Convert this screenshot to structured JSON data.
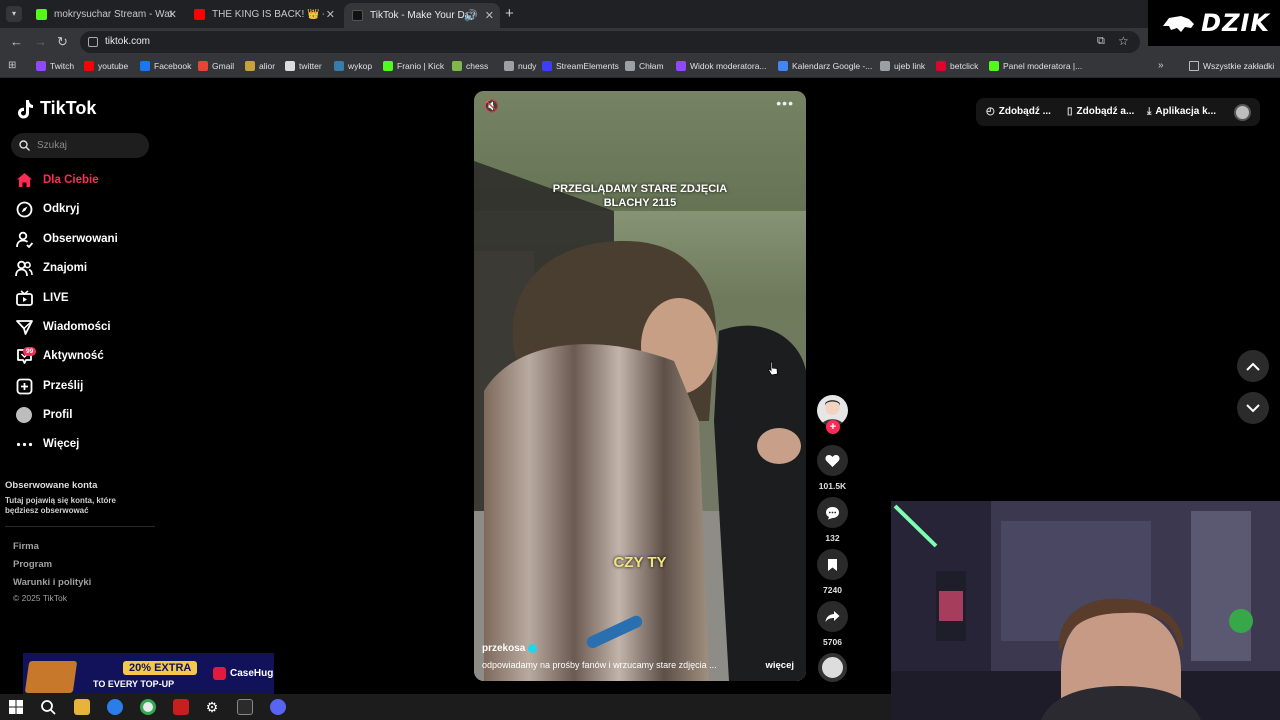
{
  "browser": {
    "tabs": [
      {
        "title": "mokrysuchar Stream - Watch Li",
        "favicon_color": "#53fc18"
      },
      {
        "title": "THE KING IS BACK! 👑 - Paweł",
        "favicon_color": "#ff0000"
      },
      {
        "title": "TikTok - Make Your Day",
        "favicon_color": "#111111"
      }
    ],
    "url": "tiktok.com",
    "bookmarks": [
      {
        "label": "Twitch",
        "color": "#9146ff"
      },
      {
        "label": "youtube",
        "color": "#ff0000"
      },
      {
        "label": "Facebook",
        "color": "#1877f2"
      },
      {
        "label": "Gmail",
        "color": "#ea4335"
      },
      {
        "label": "alior",
        "color": "#c8a13a"
      },
      {
        "label": "twitter",
        "color": "#dddddd"
      },
      {
        "label": "wykop",
        "color": "#367da9"
      },
      {
        "label": "Franio | Kick",
        "color": "#53fc18"
      },
      {
        "label": "chess",
        "color": "#81b64c"
      },
      {
        "label": "nudy",
        "color": "#9aa0a6"
      },
      {
        "label": "StreamElements",
        "color": "#3c3cff"
      },
      {
        "label": "Chłam",
        "color": "#9aa0a6"
      },
      {
        "label": "Widok moderatora...",
        "color": "#9146ff"
      },
      {
        "label": "Kalendarz Google -...",
        "color": "#4285f4"
      },
      {
        "label": "ujeb link",
        "color": "#9aa0a6"
      },
      {
        "label": "betclick",
        "color": "#e4002b"
      },
      {
        "label": "Panel moderatora |...",
        "color": "#53fc18"
      }
    ],
    "all_bookmarks": "Wszystkie zakładki",
    "logo_text": "DZIK"
  },
  "tiktok": {
    "brand": "TikTok",
    "search_placeholder": "Szukaj",
    "nav": [
      {
        "label": "Dla Ciebie",
        "icon": "home-icon",
        "active": true
      },
      {
        "label": "Odkryj",
        "icon": "compass-icon"
      },
      {
        "label": "Obserwowani",
        "icon": "following-icon"
      },
      {
        "label": "Znajomi",
        "icon": "friends-icon"
      },
      {
        "label": "LIVE",
        "icon": "live-icon"
      },
      {
        "label": "Wiadomości",
        "icon": "messages-icon"
      },
      {
        "label": "Aktywność",
        "icon": "activity-icon",
        "badge": "99"
      },
      {
        "label": "Prześlij",
        "icon": "upload-icon"
      },
      {
        "label": "Profil",
        "icon": "profile-icon"
      },
      {
        "label": "Więcej",
        "icon": "more-icon"
      }
    ],
    "followed_accounts": {
      "heading": "Obserwowane konta",
      "description": "Tutaj pojawią się konta, które będziesz obserwować"
    },
    "footer": {
      "links": [
        "Firma",
        "Program",
        "Warunki i polityki"
      ],
      "copyright": "© 2025 TikTok"
    },
    "header": {
      "coins": "Zdobądź ...",
      "app": "Zdobądź a...",
      "download": "Aplikacja k..."
    },
    "video": {
      "overlay_title_line1": "PRZEGLĄDAMY STARE ZDJĘCIA",
      "overlay_title_line2": "BLACHY 2115",
      "caption": "CZY TY",
      "author": "przekosa",
      "description": "odpowiadamy na prośby fanów i wrzucamy stare zdjęcia ...",
      "more": "więcej"
    },
    "actions": {
      "likes": "101.5K",
      "comments": "132",
      "saves": "7240",
      "shares": "5706"
    }
  },
  "ad": {
    "headline": "20% EXTRA",
    "subline": "TO EVERY TOP-UP",
    "brand": "CaseHug"
  }
}
